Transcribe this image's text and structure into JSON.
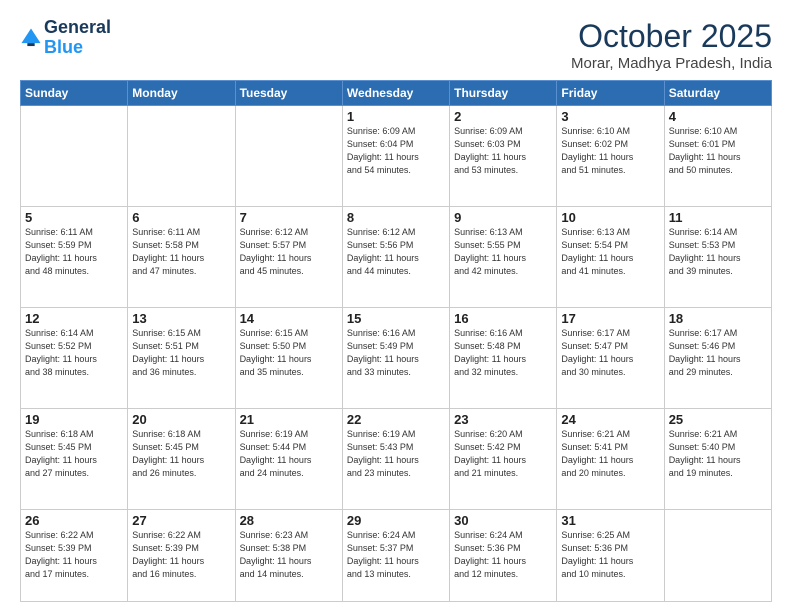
{
  "header": {
    "logo_line1": "General",
    "logo_line2": "Blue",
    "title": "October 2025",
    "subtitle": "Morar, Madhya Pradesh, India"
  },
  "weekdays": [
    "Sunday",
    "Monday",
    "Tuesday",
    "Wednesday",
    "Thursday",
    "Friday",
    "Saturday"
  ],
  "weeks": [
    [
      {
        "day": "",
        "info": ""
      },
      {
        "day": "",
        "info": ""
      },
      {
        "day": "",
        "info": ""
      },
      {
        "day": "1",
        "info": "Sunrise: 6:09 AM\nSunset: 6:04 PM\nDaylight: 11 hours\nand 54 minutes."
      },
      {
        "day": "2",
        "info": "Sunrise: 6:09 AM\nSunset: 6:03 PM\nDaylight: 11 hours\nand 53 minutes."
      },
      {
        "day": "3",
        "info": "Sunrise: 6:10 AM\nSunset: 6:02 PM\nDaylight: 11 hours\nand 51 minutes."
      },
      {
        "day": "4",
        "info": "Sunrise: 6:10 AM\nSunset: 6:01 PM\nDaylight: 11 hours\nand 50 minutes."
      }
    ],
    [
      {
        "day": "5",
        "info": "Sunrise: 6:11 AM\nSunset: 5:59 PM\nDaylight: 11 hours\nand 48 minutes."
      },
      {
        "day": "6",
        "info": "Sunrise: 6:11 AM\nSunset: 5:58 PM\nDaylight: 11 hours\nand 47 minutes."
      },
      {
        "day": "7",
        "info": "Sunrise: 6:12 AM\nSunset: 5:57 PM\nDaylight: 11 hours\nand 45 minutes."
      },
      {
        "day": "8",
        "info": "Sunrise: 6:12 AM\nSunset: 5:56 PM\nDaylight: 11 hours\nand 44 minutes."
      },
      {
        "day": "9",
        "info": "Sunrise: 6:13 AM\nSunset: 5:55 PM\nDaylight: 11 hours\nand 42 minutes."
      },
      {
        "day": "10",
        "info": "Sunrise: 6:13 AM\nSunset: 5:54 PM\nDaylight: 11 hours\nand 41 minutes."
      },
      {
        "day": "11",
        "info": "Sunrise: 6:14 AM\nSunset: 5:53 PM\nDaylight: 11 hours\nand 39 minutes."
      }
    ],
    [
      {
        "day": "12",
        "info": "Sunrise: 6:14 AM\nSunset: 5:52 PM\nDaylight: 11 hours\nand 38 minutes."
      },
      {
        "day": "13",
        "info": "Sunrise: 6:15 AM\nSunset: 5:51 PM\nDaylight: 11 hours\nand 36 minutes."
      },
      {
        "day": "14",
        "info": "Sunrise: 6:15 AM\nSunset: 5:50 PM\nDaylight: 11 hours\nand 35 minutes."
      },
      {
        "day": "15",
        "info": "Sunrise: 6:16 AM\nSunset: 5:49 PM\nDaylight: 11 hours\nand 33 minutes."
      },
      {
        "day": "16",
        "info": "Sunrise: 6:16 AM\nSunset: 5:48 PM\nDaylight: 11 hours\nand 32 minutes."
      },
      {
        "day": "17",
        "info": "Sunrise: 6:17 AM\nSunset: 5:47 PM\nDaylight: 11 hours\nand 30 minutes."
      },
      {
        "day": "18",
        "info": "Sunrise: 6:17 AM\nSunset: 5:46 PM\nDaylight: 11 hours\nand 29 minutes."
      }
    ],
    [
      {
        "day": "19",
        "info": "Sunrise: 6:18 AM\nSunset: 5:45 PM\nDaylight: 11 hours\nand 27 minutes."
      },
      {
        "day": "20",
        "info": "Sunrise: 6:18 AM\nSunset: 5:45 PM\nDaylight: 11 hours\nand 26 minutes."
      },
      {
        "day": "21",
        "info": "Sunrise: 6:19 AM\nSunset: 5:44 PM\nDaylight: 11 hours\nand 24 minutes."
      },
      {
        "day": "22",
        "info": "Sunrise: 6:19 AM\nSunset: 5:43 PM\nDaylight: 11 hours\nand 23 minutes."
      },
      {
        "day": "23",
        "info": "Sunrise: 6:20 AM\nSunset: 5:42 PM\nDaylight: 11 hours\nand 21 minutes."
      },
      {
        "day": "24",
        "info": "Sunrise: 6:21 AM\nSunset: 5:41 PM\nDaylight: 11 hours\nand 20 minutes."
      },
      {
        "day": "25",
        "info": "Sunrise: 6:21 AM\nSunset: 5:40 PM\nDaylight: 11 hours\nand 19 minutes."
      }
    ],
    [
      {
        "day": "26",
        "info": "Sunrise: 6:22 AM\nSunset: 5:39 PM\nDaylight: 11 hours\nand 17 minutes."
      },
      {
        "day": "27",
        "info": "Sunrise: 6:22 AM\nSunset: 5:39 PM\nDaylight: 11 hours\nand 16 minutes."
      },
      {
        "day": "28",
        "info": "Sunrise: 6:23 AM\nSunset: 5:38 PM\nDaylight: 11 hours\nand 14 minutes."
      },
      {
        "day": "29",
        "info": "Sunrise: 6:24 AM\nSunset: 5:37 PM\nDaylight: 11 hours\nand 13 minutes."
      },
      {
        "day": "30",
        "info": "Sunrise: 6:24 AM\nSunset: 5:36 PM\nDaylight: 11 hours\nand 12 minutes."
      },
      {
        "day": "31",
        "info": "Sunrise: 6:25 AM\nSunset: 5:36 PM\nDaylight: 11 hours\nand 10 minutes."
      },
      {
        "day": "",
        "info": ""
      }
    ]
  ]
}
